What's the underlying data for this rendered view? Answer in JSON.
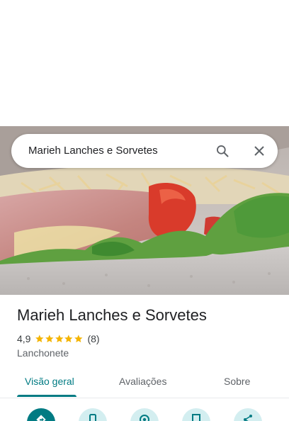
{
  "search": {
    "query": "Marieh Lanches e Sorvetes",
    "search_icon": "search-icon",
    "close_icon": "close-icon"
  },
  "hero": {
    "image": "sandwich-photo"
  },
  "place": {
    "name": "Marieh Lanches e Sorvetes",
    "rating": "4,9",
    "stars": 5,
    "review_count": "(8)",
    "category": "Lanchonete"
  },
  "tabs": [
    {
      "label": "Visão geral",
      "active": true
    },
    {
      "label": "Avaliações",
      "active": false
    },
    {
      "label": "Sobre",
      "active": false
    }
  ],
  "actions": [
    {
      "icon": "directions-icon"
    },
    {
      "icon": "phone-icon"
    },
    {
      "icon": "location-icon"
    },
    {
      "icon": "save-icon"
    },
    {
      "icon": "share-icon"
    }
  ],
  "colors": {
    "accent": "#017b83",
    "accent_light": "#d3eef0",
    "star": "#f4b400"
  }
}
